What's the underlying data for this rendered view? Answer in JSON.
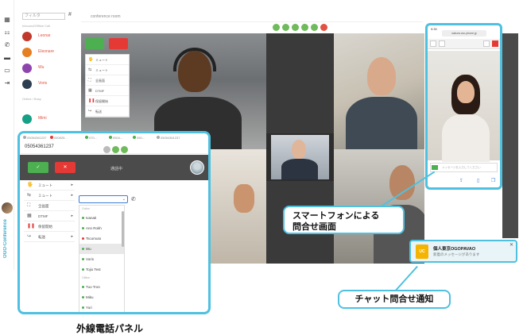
{
  "rail": {
    "icons": [
      "grid-icon",
      "org-icon",
      "phone-icon",
      "folder-icon",
      "chat-icon",
      "logout-icon"
    ],
    "brand_text": "OGO-Conference"
  },
  "sidebar": {
    "filter_placeholder": "フィルタ",
    "hash": "#",
    "section1": "Inbound/Offline Call",
    "section2": "Online / Busy",
    "contacts": [
      {
        "name": "Leonar",
        "color": "#e15240"
      },
      {
        "name": "Eleonare",
        "color": "#e15240"
      },
      {
        "name": "Wu",
        "color": "#e15240"
      },
      {
        "name": "Voris",
        "color": "#e15240"
      },
      {
        "name": "Mimi",
        "color": "#e15240"
      }
    ]
  },
  "conference": {
    "title": "conference room",
    "menu": [
      {
        "icon": "🖐",
        "label": "ミュート"
      },
      {
        "icon": "⇆",
        "label": "ミュート"
      },
      {
        "icon": "⛶",
        "label": "全画面"
      },
      {
        "icon": "▦",
        "label": "DTMF"
      },
      {
        "icon": "❚❚",
        "label": "保留開始"
      },
      {
        "icon": "↪",
        "label": "転送"
      }
    ]
  },
  "phone_panel": {
    "tabs": [
      "05054361237",
      "050525...",
      "070...",
      "0504...",
      "050...",
      "05054361237"
    ],
    "number": "05054361237",
    "accept_label": "✓",
    "reject_label": "✕",
    "status": "通話中",
    "menu": [
      {
        "icon": "🖐",
        "label": "ミュート",
        "red": false
      },
      {
        "icon": "⇆",
        "label": "ミュート",
        "red": false
      },
      {
        "icon": "⛶",
        "label": "全画面",
        "red": false
      },
      {
        "icon": "▦",
        "label": "DTMF",
        "red": false
      },
      {
        "icon": "❚❚",
        "label": "保留開始",
        "red": true
      },
      {
        "icon": "↪",
        "label": "転送",
        "red": false
      }
    ],
    "list_header": "Online",
    "list": [
      "Ivanati",
      "Ann Rokh",
      "Tscomuto",
      "Wu",
      "Voris",
      "Tojio Test"
    ],
    "list_header2": "Offline",
    "list2": [
      "Tuo Tron",
      "Miku",
      "Yuri"
    ],
    "selected": "Wu"
  },
  "smartphone": {
    "time": "9:30",
    "url": "sakura.ovc-phone.jp",
    "chat_placeholder": "メッセージを入力してください",
    "bottom_icons": [
      "share-icon",
      "book-icon",
      "tabs-icon"
    ]
  },
  "notification": {
    "logo": "UC",
    "title": "個人東京OGOPAVAO",
    "subtitle": "新着のメッセージがあります",
    "close": "✕"
  },
  "callouts": {
    "smartphone_line1": "スマートフォンによる",
    "smartphone_line2": "問合せ画面",
    "chat": "チャット問合せ通知",
    "phone_caption": "外線電話パネル"
  },
  "colors": {
    "accent": "#4fc1e0",
    "green": "#4caf50",
    "red": "#e53935"
  }
}
